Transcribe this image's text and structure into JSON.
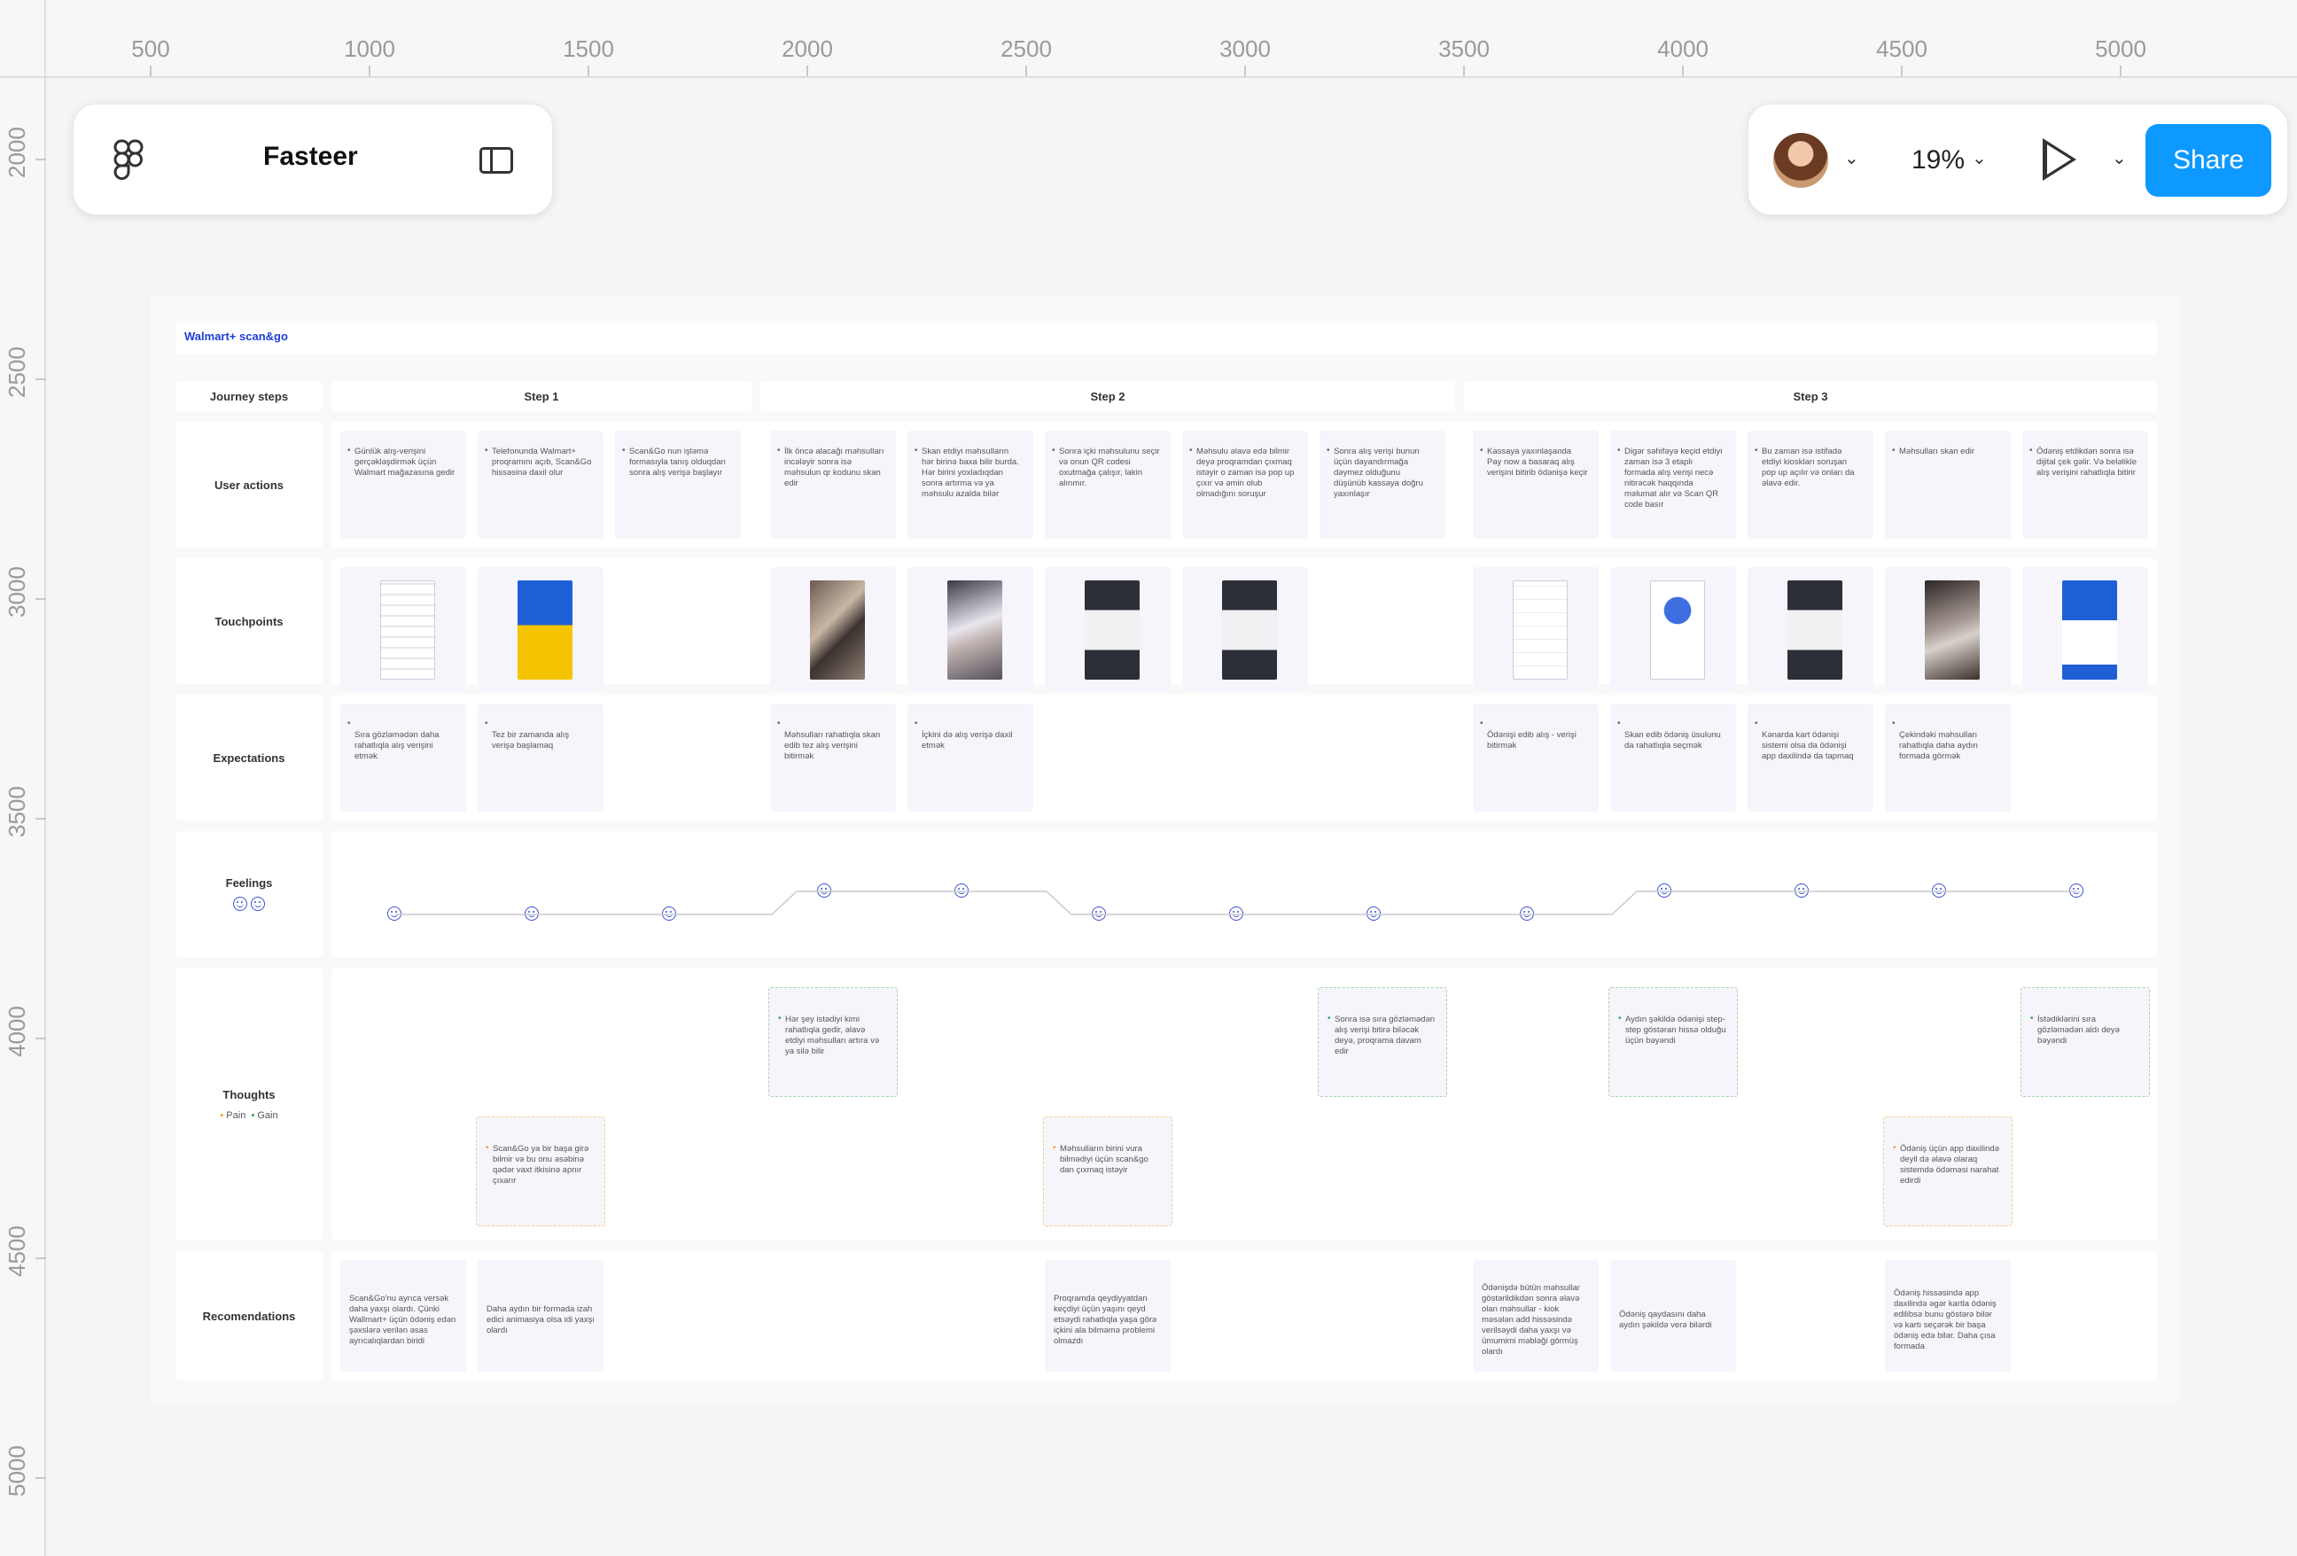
{
  "app": {
    "title": "Fasteer",
    "zoom": "19%",
    "share_label": "Share"
  },
  "icons": {
    "figma": "figma-logo-icon",
    "sidebar_toggle": "sidebar-layout-icon",
    "play": "play-icon",
    "chevron": "chevron-down-icon"
  },
  "colors": {
    "share_button": "#0d99ff",
    "journey_title": "#1e3dd6",
    "feeling_icon": "#3b52c9",
    "gain_border": "#a8d7a8",
    "pain_border": "#f4cf8c"
  },
  "rulers": {
    "top": [
      "500",
      "1000",
      "1500",
      "2000",
      "2500",
      "3000",
      "3500",
      "4000",
      "4500",
      "5000"
    ],
    "left": [
      "2000",
      "2500",
      "3000",
      "3500",
      "4000",
      "4500",
      "5000"
    ]
  },
  "journey": {
    "title": "Walmart+ scan&go",
    "row_labels": {
      "steps": "Journey steps",
      "actions": "User actions",
      "touchpoints": "Touchpoints",
      "expectations": "Expectations",
      "feelings": "Feelings",
      "thoughts": "Thoughts",
      "recommendations": "Recomendations"
    },
    "legend": {
      "pain": "Pain",
      "gain": "Gain"
    },
    "steps": [
      "Step 1",
      "Step 2",
      "Step 3"
    ],
    "actions": [
      "Günlük alış-verişini gerçəkləşdirmək üçün Walmart mağazasına gedir",
      "Telefonunda Walmart+ proqramını açıb, Scan&Go hissəsinə daxil olur",
      "Scan&Go nun işləmə formasıyla tanış olduqdan sonra alış verişə başlayır",
      "İlk öncə alacağı məhsulları incələyir sonra isə məhsulun qr kodunu skan edir",
      "Skan etdiyi məhsulların hər birinə baxa bilir burda. Hər birini yoxladıqdan sonra artırma və ya məhsulu azalda bilər",
      "Sonra içki məhsulunu seçir və onun QR codesi oxutmağa çalışır, lakin alınmır.",
      "Məhsulu əlavə edə bilmir deyə proqramdan çıxmaq istəyir o zaman isə pop up çıxır və əmin olub olmadığını soruşur",
      "Sonra alış verişi bunun üçün dayandırmağa dəymez olduğunu düşünüb kassaya doğru yaxınlaşır",
      "Kassaya yaxınlaşanda Pay now a basaraq alış verişini bitirib ödənişə keçir",
      "Digər səhifəyə keçid etdiyi zaman isə 3 etaplı formada alış verişi necə nitirəcək haqqında məlumat alır və Scan QR code basır",
      "Bu zaman isə istifadə etdiyi kioskları soruşan pop up açılır və onları da əlavə edir.",
      "Məhsulları skan edir",
      "Ödəniş etdikdən sonra isə dijital çek gəlir. Və beləlikle alış verişini rahatlıqla bitirir"
    ],
    "expectations": [
      {
        "col": 0,
        "text": "Sıra gözləmədən daha rahatlıqla alış verişini etmək"
      },
      {
        "col": 1,
        "text": "Tez bir zamanda alış verişə başlamaq"
      },
      {
        "col": 3,
        "text": "Məhsulları rahatlıqla skan edib tez alış verişini bitirmək"
      },
      {
        "col": 4,
        "text": "İçkini də alış verişə daxil etmək"
      },
      {
        "col": 8,
        "text": "Ödənişi edib alış - verişi bitirmək"
      },
      {
        "col": 9,
        "text": "Skan edib ödəniş üsulunu da rahatlıqla seçmək"
      },
      {
        "col": 10,
        "text": "Kənarda kart ödənişi sistemi olsa da ödənişi app daxilində da tapmaq"
      },
      {
        "col": 11,
        "text": "Çekindəki məhsulları rahatlıqla daha aydın formada görmək"
      }
    ],
    "feelings": [
      0,
      0,
      0,
      1,
      1,
      0,
      0,
      0,
      0,
      1,
      1,
      1,
      1
    ],
    "thoughts": [
      {
        "col": 1,
        "type": "pain",
        "text": "Scan&Go ya bir başa girə bilmir və bu onu əsəbinə qədər vaxt itkisinə apnır çıxarır"
      },
      {
        "col": 3,
        "type": "gain",
        "text": "Hər şey istədiyi kimi rahatlıqla gedir, əlavə etdiyi məhsulları artıra və ya silə bilir"
      },
      {
        "col": 5,
        "type": "pain",
        "text": "Məhsulların birini vura bilmədiyi üçün scan&go dan çıxmaq istəyir"
      },
      {
        "col": 7,
        "type": "gain",
        "text": "Sonra isə sıra gözləmədən alış verişi bitirə biləcək deyə, proqrama davam edir"
      },
      {
        "col": 9,
        "type": "gain",
        "text": "Aydın şəkildə ödənişi step-step göstəran hissə olduğu üçün bəyəndi"
      },
      {
        "col": 11,
        "type": "pain",
        "text": "Ödəniş üçün app daxilində deyil də əlavə olaraq sistemdə ödəməsi narahat edirdi"
      },
      {
        "col": 12,
        "type": "gain",
        "text": "İstədiklərini sıra gözləmədən aldı deyə bəyəndi"
      }
    ],
    "recommendations": [
      {
        "col": 0,
        "text": "Scan&Go'nu ayrıca versək daha yaxşı olardı. Çünki Wallmart+ üçün ödəniş edən şəxslərə verilən əsas ayrıcalıqlardan biridi"
      },
      {
        "col": 1,
        "text": "Daha aydın bir formada izah edici animasiya olsa idi yaxşı olardı"
      },
      {
        "col": 5,
        "text": "Proqramda qeydiyyatdan keçdiyi üçün yaşını qeyd etsəydi rahatlıqla yaşa görə içkini ala bilməmə problemi olmazdı"
      },
      {
        "col": 8,
        "text": "Ödənişdə bütün məhsullar göstərildikdən sonra əlavə olan məhsullar - kiok məsələn add hissəsində verilsəydi daha yaxşı və ümumimi məbləği görmüş olardı"
      },
      {
        "col": 9,
        "text": "Ödəniş qaydasını daha aydın şəkildə verə bilərdi"
      },
      {
        "col": 11,
        "text": "Ödəniş hissəsində app daxilində əgər kartla ödəniş edilibsə bunu göstərə bilər və kartı seçərək bir başa ödəniş edə bilər. Daha çısa formada"
      }
    ],
    "touchpoints": [
      {
        "col": 0,
        "screen": "app-grid"
      },
      {
        "col": 1,
        "screen": "welcome-yellow"
      },
      {
        "col": 3,
        "screen": "photo-store"
      },
      {
        "col": 4,
        "screen": "photo-hand"
      },
      {
        "col": 5,
        "screen": "dark-dialog"
      },
      {
        "col": 6,
        "screen": "dark-dialog"
      },
      {
        "col": 8,
        "screen": "white-list"
      },
      {
        "col": 9,
        "screen": "white-illustration"
      },
      {
        "col": 10,
        "screen": "dark-dialog"
      },
      {
        "col": 11,
        "screen": "photo-kiosk"
      },
      {
        "col": 12,
        "screen": "blue-receipt"
      }
    ]
  }
}
